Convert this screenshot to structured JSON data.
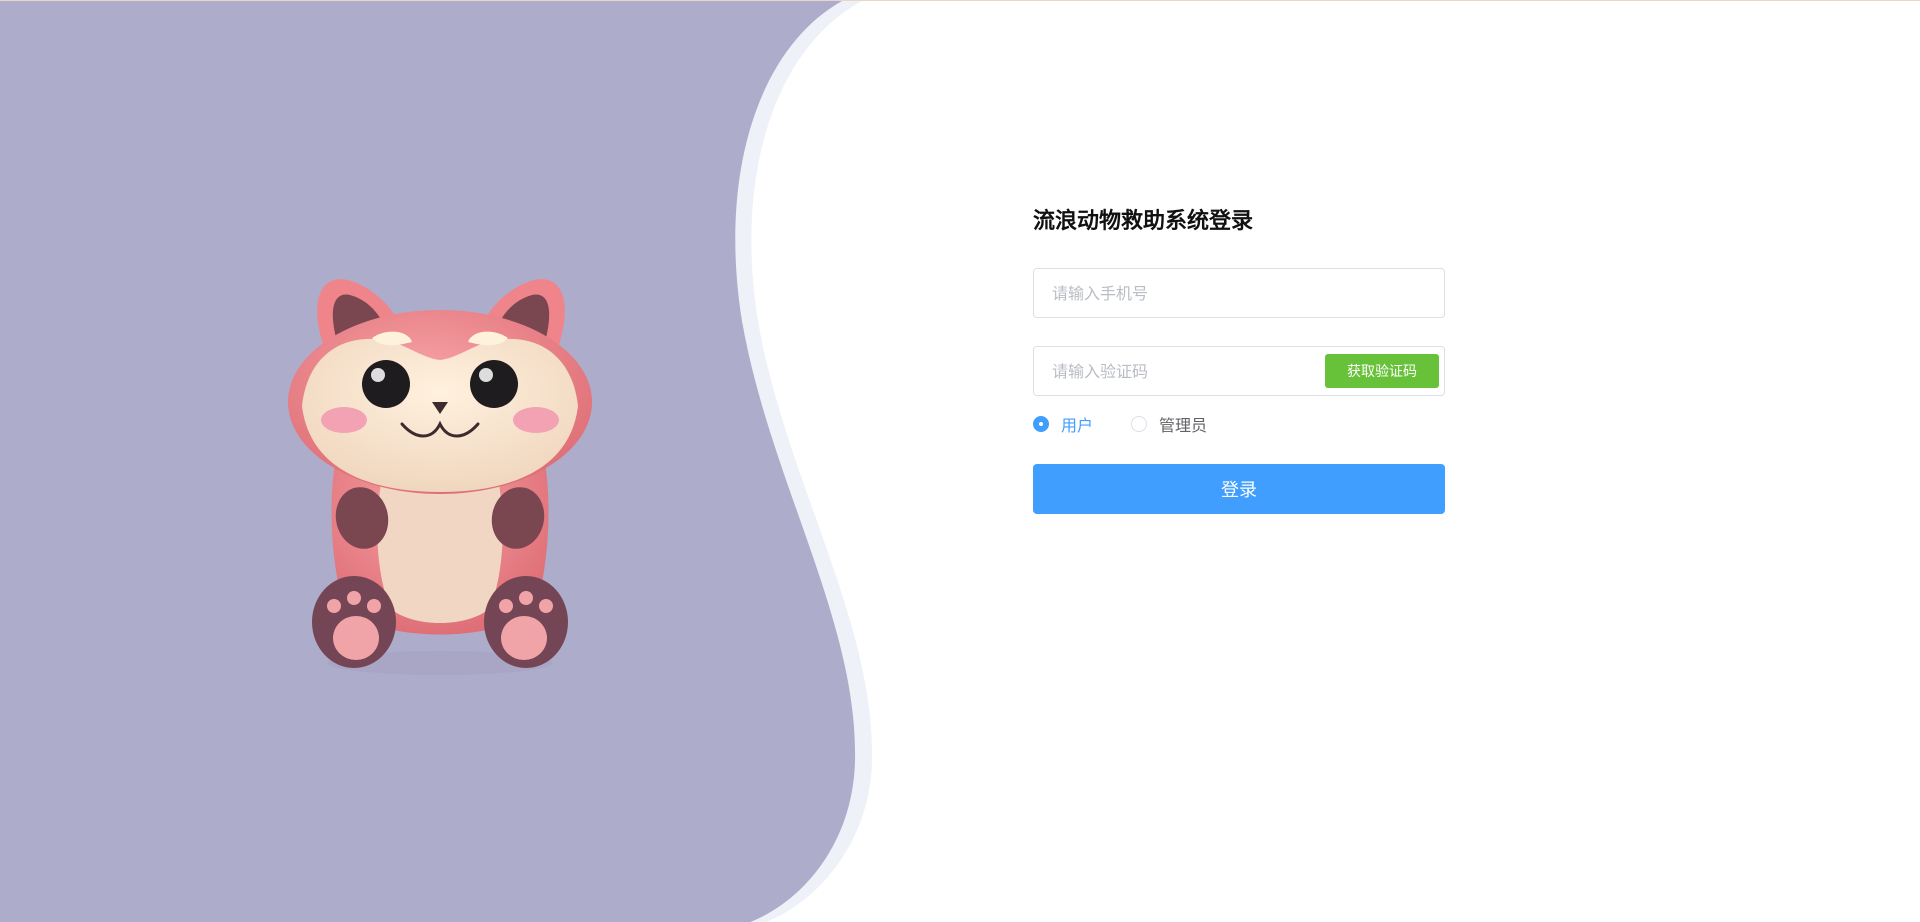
{
  "login": {
    "title": "流浪动物救助系统登录",
    "phone_placeholder": "请输入手机号",
    "code_placeholder": "请输入验证码",
    "get_code_label": "获取验证码",
    "roles": [
      {
        "label": "用户",
        "selected": true
      },
      {
        "label": "管理员",
        "selected": false
      }
    ],
    "submit_label": "登录"
  },
  "colors": {
    "left_background": "#aeaccb",
    "wave_edge": "#f0f3f8",
    "primary": "#409eff",
    "code_button": "#67c23a",
    "title": "#111111"
  },
  "icons": {
    "mascot": "red-panda-mascot-illustration"
  }
}
